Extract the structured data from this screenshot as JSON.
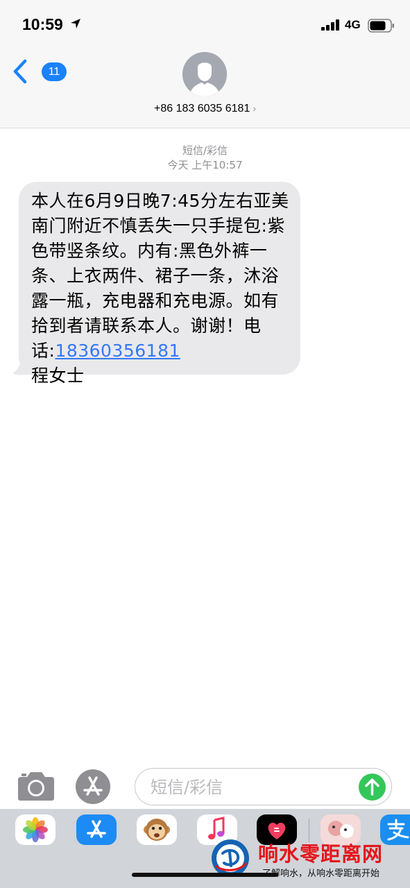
{
  "status_bar": {
    "time": "10:59",
    "network": "4G"
  },
  "header": {
    "back_badge": "11",
    "contact": "+86 183 6035 6181",
    "contact_chevron": "›"
  },
  "conversation": {
    "service_label": "短信/彩信",
    "timestamp": "今天 上午10:57",
    "message": {
      "text_before_link": "本人在6月9日晚7:45分左右亚美南门附近不慎丢失一只手提包:紫色带竖条纹。内有:黑色外裤一条、上衣两件、裙子一条，沐浴露一瓶，充电器和充电源。如有拾到者请联系本人。谢谢！电话:",
      "phone_link": "18360356181",
      "text_after_link": "程女士"
    }
  },
  "input": {
    "placeholder": "短信/彩信"
  },
  "app_drawer": {
    "apps": [
      "photos-app",
      "app-store-app",
      "animoji-app",
      "music-app",
      "digital-touch-app",
      "sticker-app",
      "alipay-app"
    ]
  },
  "watermark": {
    "title": "响水零距离网",
    "subtitle": "了解响水，从响水零距离开始"
  },
  "colors": {
    "accent": "#1a82fb",
    "send": "#34c759",
    "bubble": "#e9e9eb",
    "link": "#3478f6",
    "watermark": "#e4161b"
  }
}
